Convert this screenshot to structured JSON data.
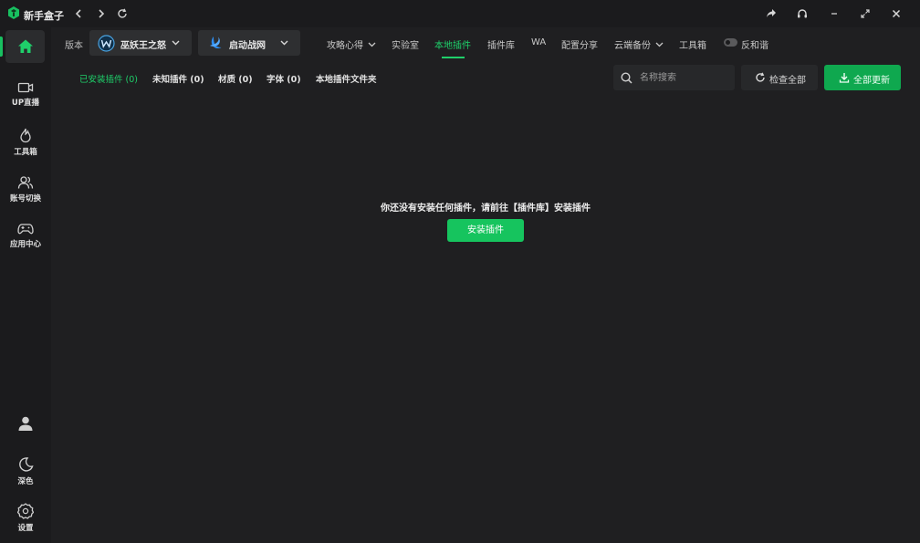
{
  "app": {
    "title": "新手盒子"
  },
  "sidebar": {
    "items": [
      {
        "label": "UP直播",
        "icon": "camera-icon"
      },
      {
        "label": "工具箱",
        "icon": "flame-icon"
      },
      {
        "label": "账号切换",
        "icon": "users-icon"
      },
      {
        "label": "应用中心",
        "icon": "gamepad-icon"
      }
    ],
    "theme_label": "深色",
    "settings_label": "设置"
  },
  "header": {
    "version_label": "版本",
    "game_select": "巫妖王之怒",
    "launcher_select": "启动战网",
    "nav": [
      "攻略心得",
      "实验室",
      "本地插件",
      "插件库",
      "WA",
      "配置分享",
      "云端备份",
      "工具箱",
      "反和谐"
    ],
    "active_nav": "本地插件"
  },
  "subtabs": [
    "已安装插件 (0)",
    "未知插件 (0)",
    "材质 (0)",
    "字体 (0)",
    "本地插件文件夹"
  ],
  "search": {
    "placeholder": "名称搜索",
    "value": ""
  },
  "buttons": {
    "check_all": "检查全部",
    "update_all": "全部更新",
    "install": "安装插件"
  },
  "empty_message": "你还没有安装任何插件，请前往【插件库】安装插件",
  "colors": {
    "accent": "#1fcf6a",
    "button_green": "#16c45e",
    "background": "#1f1f21",
    "sidebar": "#1b1b1d"
  }
}
